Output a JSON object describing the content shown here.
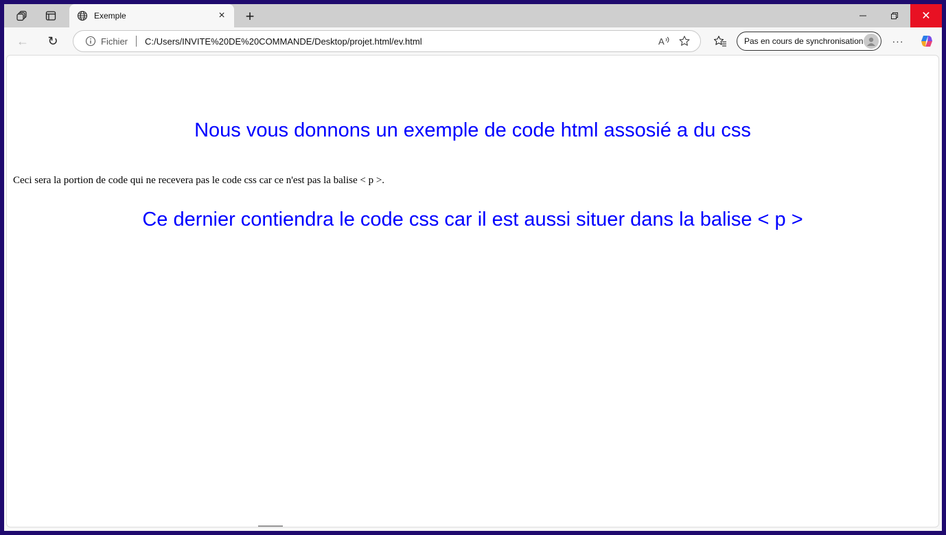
{
  "tabbar": {
    "tab_title": "Exemple",
    "tab_icon": "globe-icon",
    "new_tab_symbol": "+",
    "close_tab_symbol": "×"
  },
  "window_controls": {
    "minimize": "—",
    "restore": "❐",
    "close": "✕",
    "close_color": "#e81123"
  },
  "toolbar": {
    "back_symbol": "←",
    "reload_symbol": "↻",
    "address_label": "Fichier",
    "address_url": "C:/Users/INVITE%20DE%20COMMANDE/Desktop/projet.html/ev.html",
    "read_aloud_symbol": "A",
    "favorite_symbol": "☆",
    "favorites_symbol": "☆",
    "sync_label": "Pas en cours de synchronisation",
    "more_symbol": "···"
  },
  "page": {
    "heading_1": "Nous vous donnons un exemple de code html assosié a du css",
    "paragraph": "Ceci sera la portion de code qui ne recevera pas le code css car ce n'est pas la balise < p >.",
    "heading_2": "Ce dernier contiendra le code css car il est aussi situer dans la balise < p >",
    "accent_color": "#0000ff"
  }
}
